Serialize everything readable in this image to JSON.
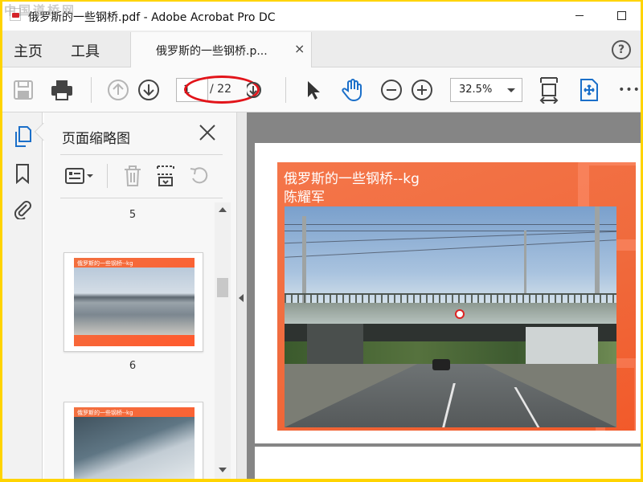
{
  "window": {
    "title": "俄罗斯的一些钢桥.pdf - Adobe Acrobat Pro DC",
    "watermark": "中国道桥网"
  },
  "tabs": {
    "home_label": "主页",
    "tools_label": "工具",
    "doc_tab_label": "俄罗斯的一些钢桥.p...",
    "close_glyph": "×",
    "help_glyph": "?"
  },
  "toolbar": {
    "current_page": "1",
    "total_pages": "/ 22",
    "zoom": "32.5%",
    "more_glyph": "•••",
    "icons": [
      "save-icon",
      "print-icon",
      "page-up-icon",
      "page-down-icon",
      "select-arrow-icon",
      "hand-icon",
      "zoom-out-icon",
      "zoom-in-icon",
      "fit-page-icon",
      "full-screen-icon",
      "more-icon"
    ]
  },
  "sidebar": {
    "icons": [
      "pages-icon",
      "bookmark-icon",
      "attachment-icon"
    ]
  },
  "thumbnails_panel": {
    "title": "页面缩略图",
    "page_labels": [
      "5",
      "6"
    ],
    "thumb_slide_title": "俄罗斯的一些钢桥--kg"
  },
  "document": {
    "slide_title": "俄罗斯的一些钢桥--kg",
    "slide_author": "陈耀军"
  },
  "colors": {
    "accent_blue": "#1b6fc9",
    "slide_orange": "#f06a3c",
    "annotation_red": "#e2141a",
    "frame_yellow": "#ffd400"
  }
}
